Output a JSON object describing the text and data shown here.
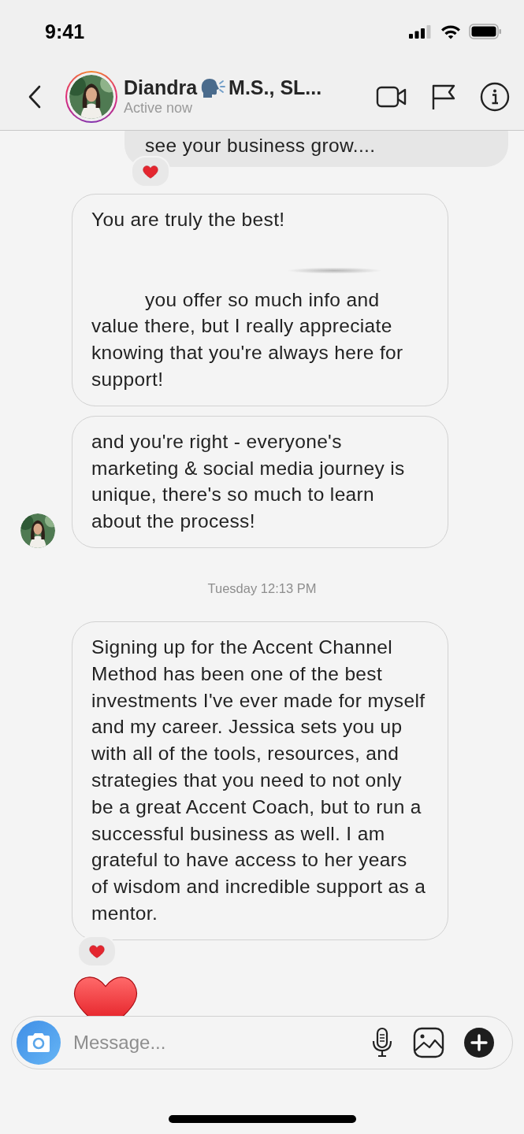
{
  "status_bar": {
    "time": "9:41"
  },
  "header": {
    "name": "Diandra",
    "name_suffix": "M.S., SL...",
    "status": "Active now"
  },
  "messages": [
    {
      "kind": "outgoing",
      "text": "see your business grow....",
      "reaction": true,
      "avatar": false
    },
    {
      "kind": "incoming",
      "text": "You are truly the best!",
      "redacted": true,
      "text_after": "you offer so much info and value there, but I really appreciate knowing that you're always here for support!",
      "reaction": false,
      "avatar": false
    },
    {
      "kind": "incoming",
      "text": "and you're right - everyone's marketing  & social media journey is unique, there's so much to learn about the process!",
      "reaction": false,
      "avatar": true
    },
    {
      "kind": "timestamp",
      "text": "Tuesday 12:13 PM"
    },
    {
      "kind": "incoming",
      "text": "Signing up for the Accent Channel Method has been one of the best investments I've ever made for myself and my career. Jessica sets you up with all of the tools, resources, and strategies that you need to not only be a great Accent Coach, but to run a successful business as well. I am grateful to have access to her years of wisdom and incredible support as a mentor.",
      "reaction": true,
      "avatar": false
    },
    {
      "kind": "heart"
    }
  ],
  "composer": {
    "placeholder": "Message..."
  }
}
